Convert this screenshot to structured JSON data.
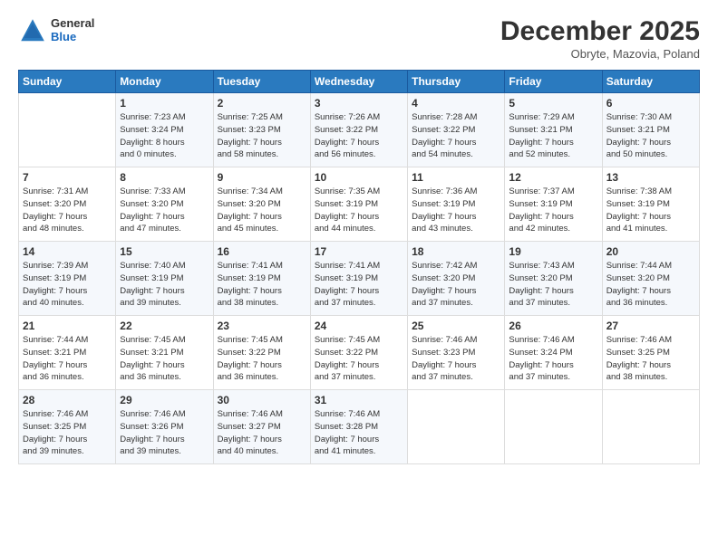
{
  "header": {
    "logo": {
      "general": "General",
      "blue": "Blue"
    },
    "title": "December 2025",
    "subtitle": "Obryte, Mazovia, Poland"
  },
  "calendar": {
    "days_of_week": [
      "Sunday",
      "Monday",
      "Tuesday",
      "Wednesday",
      "Thursday",
      "Friday",
      "Saturday"
    ],
    "weeks": [
      [
        {
          "day": "",
          "info": ""
        },
        {
          "day": "1",
          "info": "Sunrise: 7:23 AM\nSunset: 3:24 PM\nDaylight: 8 hours\nand 0 minutes."
        },
        {
          "day": "2",
          "info": "Sunrise: 7:25 AM\nSunset: 3:23 PM\nDaylight: 7 hours\nand 58 minutes."
        },
        {
          "day": "3",
          "info": "Sunrise: 7:26 AM\nSunset: 3:22 PM\nDaylight: 7 hours\nand 56 minutes."
        },
        {
          "day": "4",
          "info": "Sunrise: 7:28 AM\nSunset: 3:22 PM\nDaylight: 7 hours\nand 54 minutes."
        },
        {
          "day": "5",
          "info": "Sunrise: 7:29 AM\nSunset: 3:21 PM\nDaylight: 7 hours\nand 52 minutes."
        },
        {
          "day": "6",
          "info": "Sunrise: 7:30 AM\nSunset: 3:21 PM\nDaylight: 7 hours\nand 50 minutes."
        }
      ],
      [
        {
          "day": "7",
          "info": "Sunrise: 7:31 AM\nSunset: 3:20 PM\nDaylight: 7 hours\nand 48 minutes."
        },
        {
          "day": "8",
          "info": "Sunrise: 7:33 AM\nSunset: 3:20 PM\nDaylight: 7 hours\nand 47 minutes."
        },
        {
          "day": "9",
          "info": "Sunrise: 7:34 AM\nSunset: 3:20 PM\nDaylight: 7 hours\nand 45 minutes."
        },
        {
          "day": "10",
          "info": "Sunrise: 7:35 AM\nSunset: 3:19 PM\nDaylight: 7 hours\nand 44 minutes."
        },
        {
          "day": "11",
          "info": "Sunrise: 7:36 AM\nSunset: 3:19 PM\nDaylight: 7 hours\nand 43 minutes."
        },
        {
          "day": "12",
          "info": "Sunrise: 7:37 AM\nSunset: 3:19 PM\nDaylight: 7 hours\nand 42 minutes."
        },
        {
          "day": "13",
          "info": "Sunrise: 7:38 AM\nSunset: 3:19 PM\nDaylight: 7 hours\nand 41 minutes."
        }
      ],
      [
        {
          "day": "14",
          "info": "Sunrise: 7:39 AM\nSunset: 3:19 PM\nDaylight: 7 hours\nand 40 minutes."
        },
        {
          "day": "15",
          "info": "Sunrise: 7:40 AM\nSunset: 3:19 PM\nDaylight: 7 hours\nand 39 minutes."
        },
        {
          "day": "16",
          "info": "Sunrise: 7:41 AM\nSunset: 3:19 PM\nDaylight: 7 hours\nand 38 minutes."
        },
        {
          "day": "17",
          "info": "Sunrise: 7:41 AM\nSunset: 3:19 PM\nDaylight: 7 hours\nand 37 minutes."
        },
        {
          "day": "18",
          "info": "Sunrise: 7:42 AM\nSunset: 3:20 PM\nDaylight: 7 hours\nand 37 minutes."
        },
        {
          "day": "19",
          "info": "Sunrise: 7:43 AM\nSunset: 3:20 PM\nDaylight: 7 hours\nand 37 minutes."
        },
        {
          "day": "20",
          "info": "Sunrise: 7:44 AM\nSunset: 3:20 PM\nDaylight: 7 hours\nand 36 minutes."
        }
      ],
      [
        {
          "day": "21",
          "info": "Sunrise: 7:44 AM\nSunset: 3:21 PM\nDaylight: 7 hours\nand 36 minutes."
        },
        {
          "day": "22",
          "info": "Sunrise: 7:45 AM\nSunset: 3:21 PM\nDaylight: 7 hours\nand 36 minutes."
        },
        {
          "day": "23",
          "info": "Sunrise: 7:45 AM\nSunset: 3:22 PM\nDaylight: 7 hours\nand 36 minutes."
        },
        {
          "day": "24",
          "info": "Sunrise: 7:45 AM\nSunset: 3:22 PM\nDaylight: 7 hours\nand 37 minutes."
        },
        {
          "day": "25",
          "info": "Sunrise: 7:46 AM\nSunset: 3:23 PM\nDaylight: 7 hours\nand 37 minutes."
        },
        {
          "day": "26",
          "info": "Sunrise: 7:46 AM\nSunset: 3:24 PM\nDaylight: 7 hours\nand 37 minutes."
        },
        {
          "day": "27",
          "info": "Sunrise: 7:46 AM\nSunset: 3:25 PM\nDaylight: 7 hours\nand 38 minutes."
        }
      ],
      [
        {
          "day": "28",
          "info": "Sunrise: 7:46 AM\nSunset: 3:25 PM\nDaylight: 7 hours\nand 39 minutes."
        },
        {
          "day": "29",
          "info": "Sunrise: 7:46 AM\nSunset: 3:26 PM\nDaylight: 7 hours\nand 39 minutes."
        },
        {
          "day": "30",
          "info": "Sunrise: 7:46 AM\nSunset: 3:27 PM\nDaylight: 7 hours\nand 40 minutes."
        },
        {
          "day": "31",
          "info": "Sunrise: 7:46 AM\nSunset: 3:28 PM\nDaylight: 7 hours\nand 41 minutes."
        },
        {
          "day": "",
          "info": ""
        },
        {
          "day": "",
          "info": ""
        },
        {
          "day": "",
          "info": ""
        }
      ]
    ]
  }
}
